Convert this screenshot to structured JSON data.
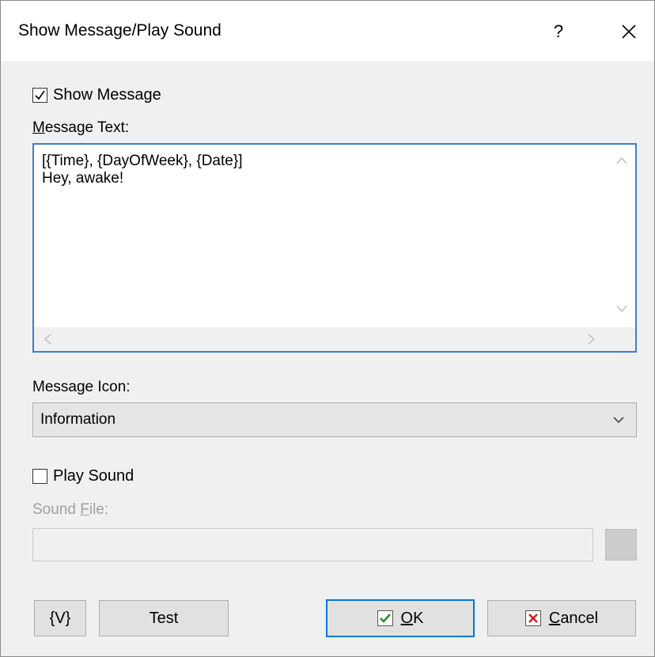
{
  "window": {
    "title": "Show Message/Play Sound",
    "help_label": "?",
    "close_icon": "close-icon"
  },
  "show_message": {
    "label": "Show Message",
    "checked": true
  },
  "message_text": {
    "label_accel": "M",
    "label_rest": "essage Text:",
    "value": "[{Time}, {DayOfWeek}, {Date}]\nHey, awake!"
  },
  "message_icon": {
    "label": "Message Icon:",
    "selected": "Information"
  },
  "play_sound": {
    "label": "Play Sound",
    "checked": false
  },
  "sound_file": {
    "label_pre": "Sound ",
    "label_accel": "F",
    "label_post": "ile:",
    "value": ""
  },
  "buttons": {
    "variables_label": "{V}",
    "test_label": "Test",
    "ok_accel": "O",
    "ok_rest": "K",
    "cancel_accel": "C",
    "cancel_rest": "ancel"
  },
  "colors": {
    "focus_border": "#3c7fce",
    "ok_check": "#2e8b2e",
    "cancel_x": "#d42020",
    "disabled_text": "#a0a0a0"
  }
}
